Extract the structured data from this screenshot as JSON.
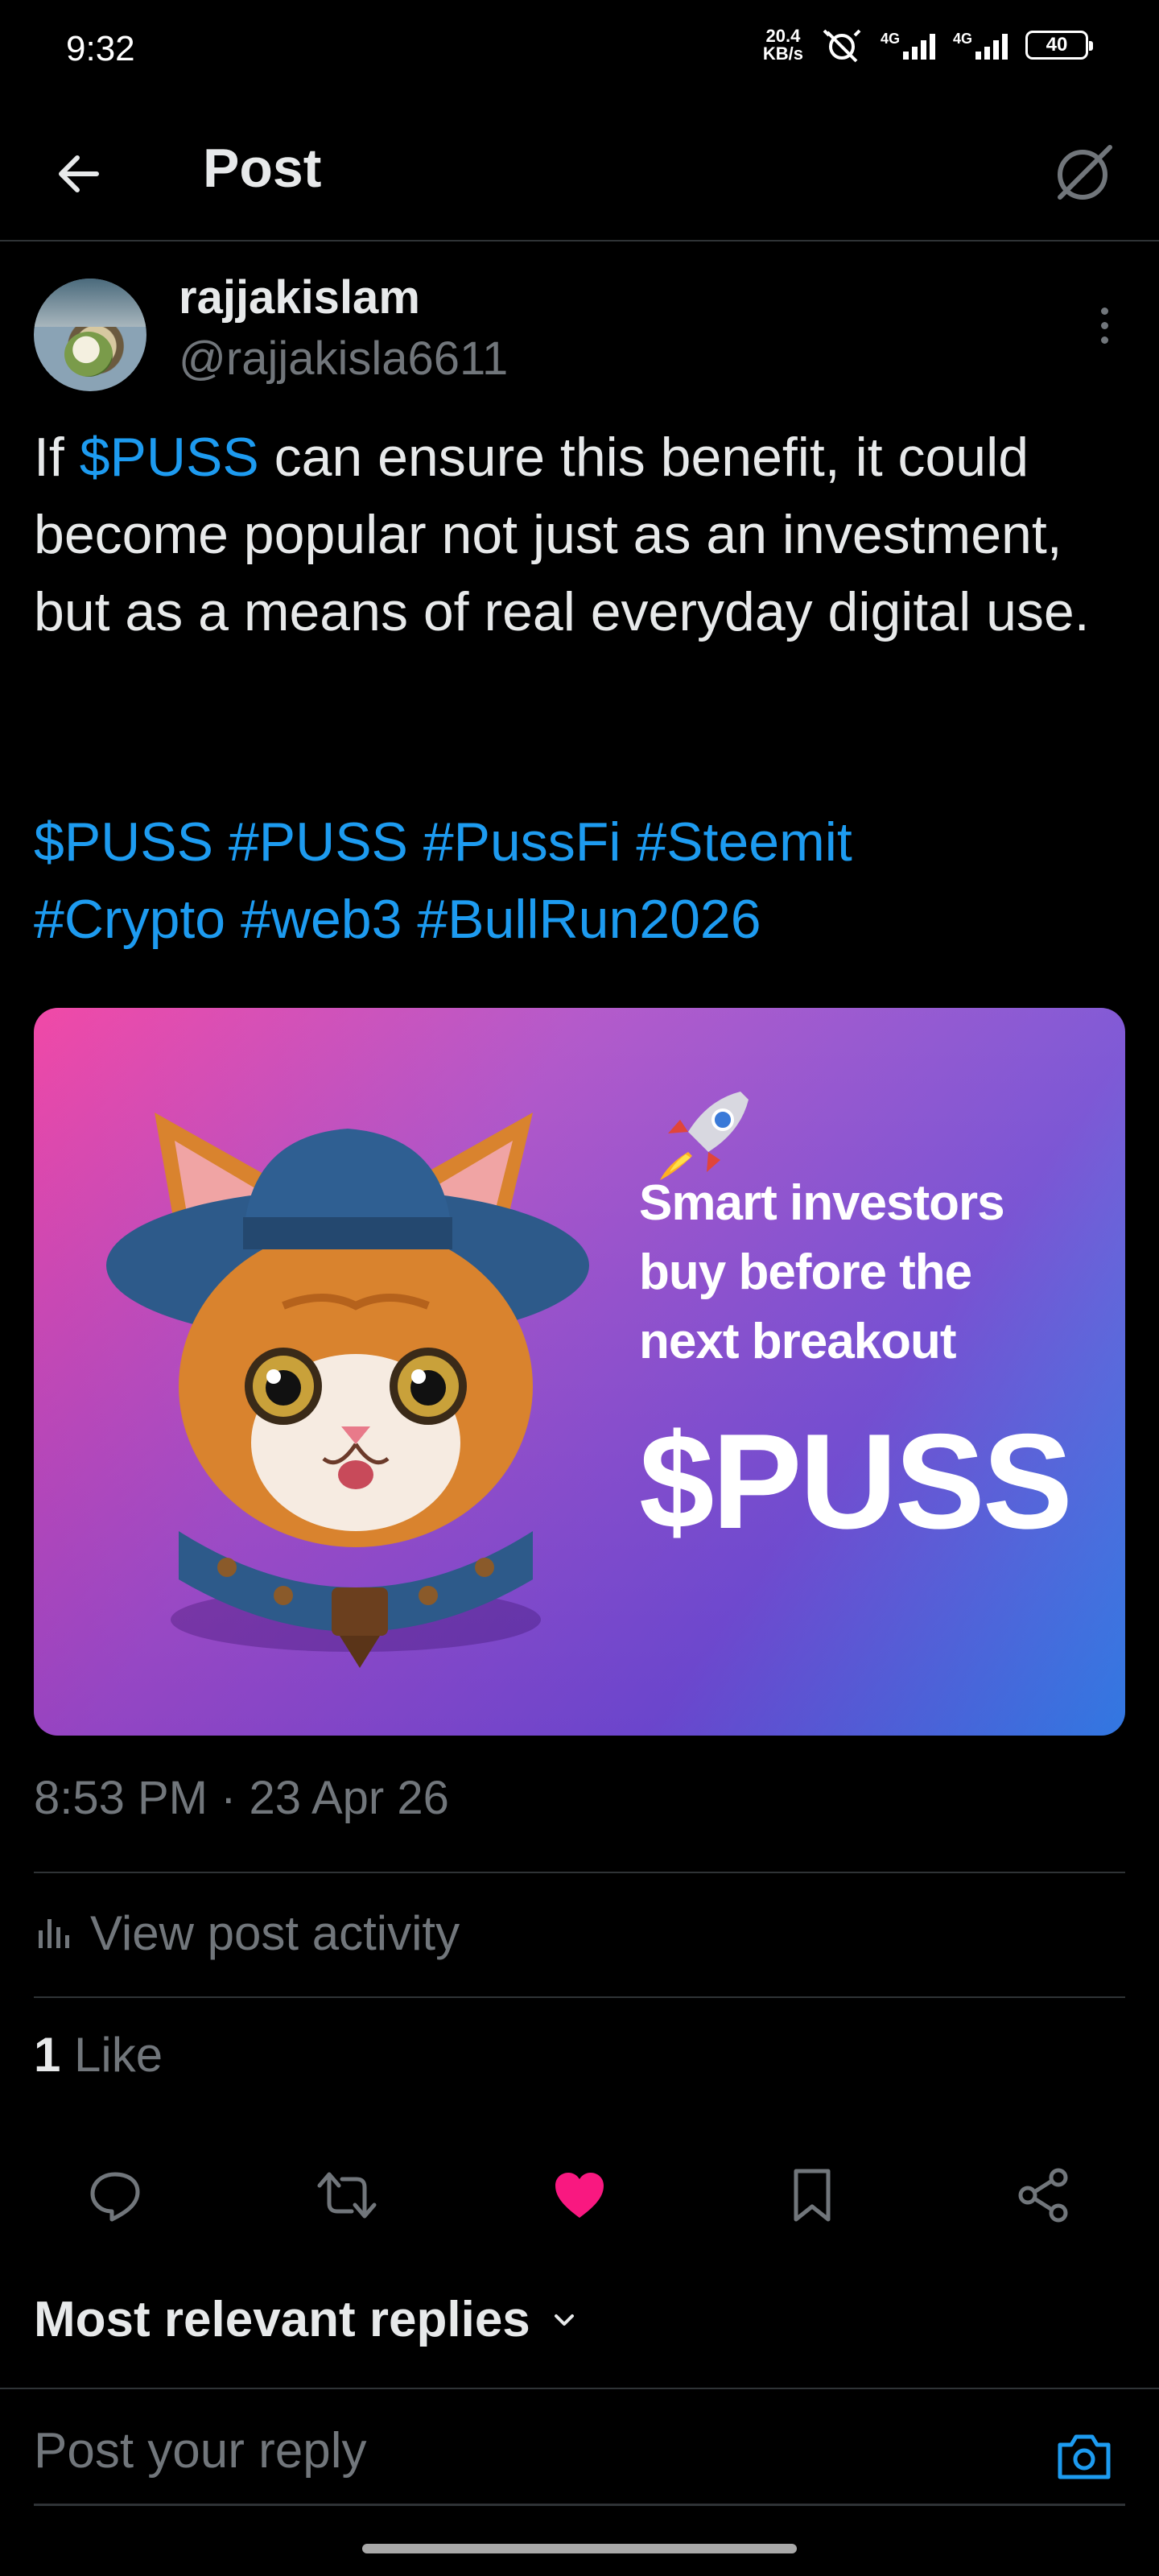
{
  "status_bar": {
    "time": "9:32",
    "speed_value": "20.4",
    "speed_unit": "KB/s",
    "network_1": "4G",
    "network_2": "4G",
    "battery": "40"
  },
  "header": {
    "title": "Post",
    "back_icon": "arrow-left-icon",
    "grok_icon": "grok-icon"
  },
  "author": {
    "name": "rajjakislam",
    "handle": "@rajjakisla6611"
  },
  "post": {
    "text_before_link": "If ",
    "cashtag": "$PUSS",
    "text_after_link": " can ensure this benefit, it could become popular not just as an investment, but as a means of real everyday digital use.",
    "hashtags": [
      "$PUSS",
      "#PUSS",
      "#PussFi",
      "#Steemit",
      "#Crypto",
      "#web3",
      "#BullRun2026"
    ],
    "timestamp": "8:53 PM · 23 Apr 26"
  },
  "media": {
    "line1": "Smart investors",
    "line2": "buy before the",
    "line3": "next breakout",
    "brand": "$PUSS",
    "colors": {
      "start": "#f03fa2",
      "mid": "#7a52d4",
      "end": "#2e95f0"
    }
  },
  "activity": {
    "label": "View post activity",
    "icon": "analytics-icon"
  },
  "likes": {
    "count": "1",
    "label": " Like"
  },
  "actions": {
    "reply_icon": "reply-icon",
    "repost_icon": "repost-icon",
    "like_icon": "heart-filled-icon",
    "bookmark_icon": "bookmark-icon",
    "share_icon": "share-icon",
    "like_color": "#f91880"
  },
  "replies": {
    "sort_label": "Most relevant replies",
    "input_placeholder": "Post your reply"
  },
  "colors": {
    "accent": "#1d9bf0",
    "muted": "#71767b",
    "text": "#e7e9ea",
    "divider": "#2f3336"
  }
}
